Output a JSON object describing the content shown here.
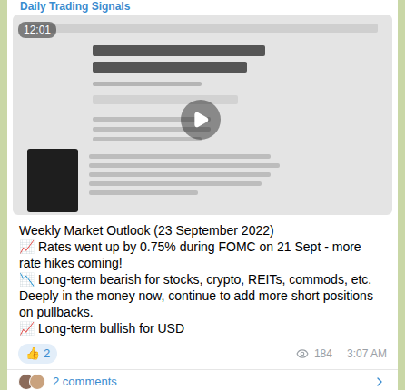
{
  "channel": {
    "name": "Daily Trading Signals"
  },
  "video": {
    "duration": "12:01"
  },
  "message": {
    "title": "Weekly Market Outlook (23 September 2022)",
    "lines": [
      {
        "icon": "📈",
        "text": "Rates went up by 0.75% during FOMC on 21 Sept - more rate hikes coming!"
      },
      {
        "icon": "📉",
        "text": "Long-term bearish for stocks, crypto, REITs, commods, etc. Deeply in the money now, continue to add more short positions on pullbacks."
      },
      {
        "icon": "📈",
        "text": "Long-term bullish for USD"
      }
    ]
  },
  "reactions": [
    {
      "emoji": "👍",
      "count": "2"
    }
  ],
  "views": "184",
  "time": "3:07 AM",
  "comments": {
    "label": "2 comments"
  }
}
